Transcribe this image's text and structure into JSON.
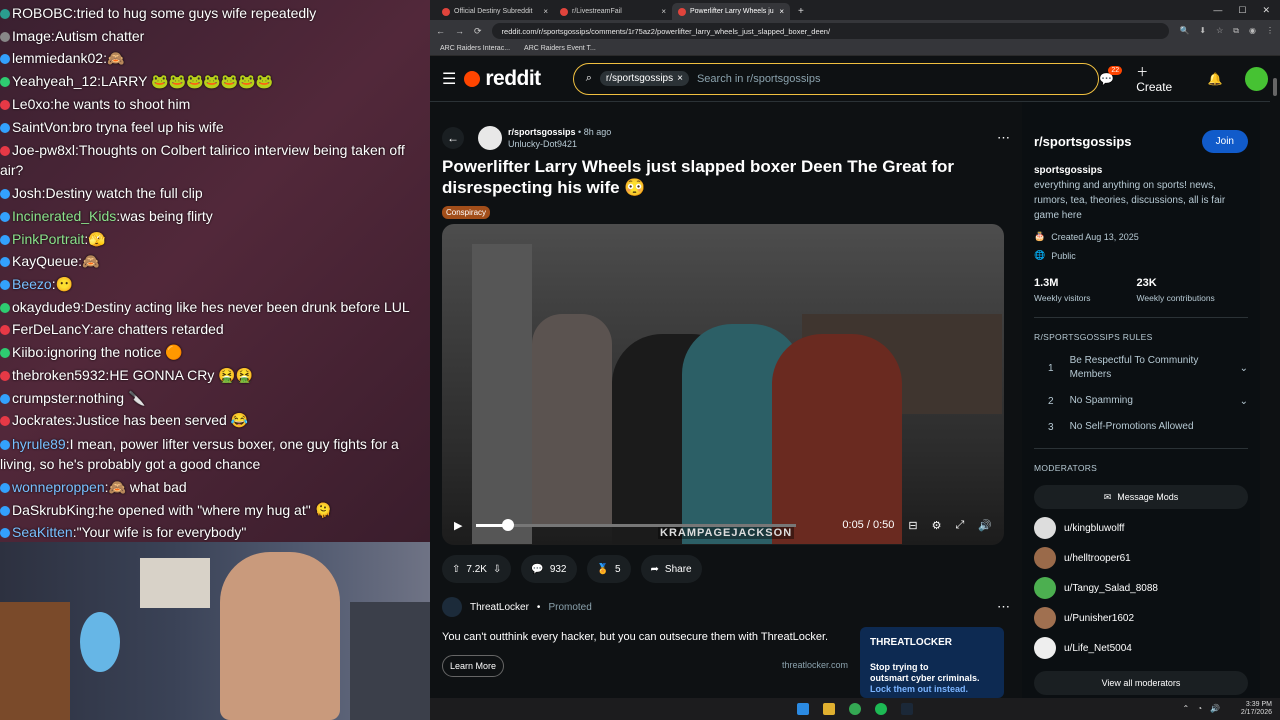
{
  "chat": [
    {
      "user": "ROBOBC",
      "text": "tried to hug some guys wife repeatedly",
      "color": "#ffffff",
      "badge": "#2a9d8f"
    },
    {
      "user": "Image",
      "text": "Autism chatter",
      "color": "#ffffff",
      "badge": "#888888"
    },
    {
      "user": "lemmiedank02",
      "text": "🙈",
      "color": "#ffffff",
      "badge": "#33a1fd"
    },
    {
      "user": "Yeahyeah_12",
      "text": "LARRY 🐸🐸🐸🐸🐸🐸🐸",
      "color": "#ffffff",
      "badge": "#2ecc71"
    },
    {
      "user": "Le0xo",
      "text": "he wants to shoot him",
      "color": "#ffffff",
      "badge": "#e63946"
    },
    {
      "user": "SaintVon",
      "text": "bro tryna feel up his wife",
      "color": "#ffffff",
      "badge": "#33a1fd"
    },
    {
      "user": "Joe-pw8xl",
      "text": "Thoughts on Colbert talirico interview being taken off air?",
      "color": "#ffffff",
      "badge": "#e63946"
    },
    {
      "user": "Josh",
      "text": "Destiny watch the full clip",
      "color": "#ffffff",
      "badge": "#33a1fd"
    },
    {
      "user": "Incinerated_Kids",
      "text": "was being flirty",
      "color": "#8be28b",
      "badge": "#33a1fd"
    },
    {
      "user": "PinkPortrait",
      "text": "🫣",
      "color": "#8be28b",
      "badge": "#33a1fd"
    },
    {
      "user": "KayQueue",
      "text": "🙈",
      "color": "#ffffff",
      "badge": "#33a1fd"
    },
    {
      "user": "Beezo",
      "text": "😶",
      "color": "#79c0ff",
      "badge": "#33a1fd"
    },
    {
      "user": "okaydude9",
      "text": "Destiny acting like hes never been drunk before LUL",
      "color": "#ffffff",
      "badge": "#2ecc71"
    },
    {
      "user": "FerDeLancY",
      "text": "are chatters retarded",
      "color": "#ffffff",
      "badge": "#e63946"
    },
    {
      "user": "Kiibo",
      "text": "ignoring the notice 🟠",
      "color": "#ffffff",
      "badge": "#2ecc71"
    },
    {
      "user": "thebroken5932",
      "text": "HE GONNA CRy 🤮🤮",
      "color": "#ffffff",
      "badge": "#e63946"
    },
    {
      "user": "crumpster",
      "text": "nothing 🔪",
      "color": "#ffffff",
      "badge": "#33a1fd"
    },
    {
      "user": "Jockrates",
      "text": "Justice has been served 😂",
      "color": "#ffffff",
      "badge": "#e63946"
    },
    {
      "user": "hyrule89",
      "text": "I mean, power lifter versus boxer, one guy fights for a living, so he's probably got a good chance",
      "color": "#79c0ff",
      "badge": "#33a1fd"
    },
    {
      "user": "wonneproppen",
      "text": "🙈 what bad",
      "color": "#79c0ff",
      "badge": "#33a1fd"
    },
    {
      "user": "DaSkrubKing",
      "text": "he opened with \"where my hug at\" 🫠",
      "color": "#ffffff",
      "badge": "#33a1fd"
    },
    {
      "user": "SeaKitten",
      "text": "\"Your wife is for everybody\"",
      "color": "#79c0ff",
      "badge": "#33a1fd"
    }
  ],
  "browser": {
    "tabs": [
      "Official Destiny Subreddit",
      "r/LivestreamFail",
      "Powerlifter Larry Wheels ju"
    ],
    "url": "reddit.com/r/sportsgossips/comments/1r75az2/powerlifter_larry_wheels_just_slapped_boxer_deen/",
    "bookmarks": [
      "ARC Raiders Interac...",
      "ARC Raiders Event T..."
    ]
  },
  "reddit": {
    "logo": "reddit",
    "search_chip": "r/sportsgossips",
    "search_placeholder": "Search in r/sportsgossips",
    "notif_count": "22",
    "create_label": "Create",
    "post": {
      "subreddit": "r/sportsgossips",
      "age": "8h ago",
      "author": "Unlucky-Dot9421",
      "title": "Powerlifter Larry Wheels just slapped boxer Deen The Great for disrespecting his wife 😳",
      "flair": "Conspiracy",
      "video_time": "0:05 / 0:50",
      "video_watermark": "KRAMPAGEJACKSON",
      "video_progress": 0.1,
      "votes": "7.2K",
      "comments": "932",
      "awards": "5",
      "share": "Share"
    },
    "promo": {
      "advertiser": "ThreatLocker",
      "promoted": "Promoted",
      "text": "You can't outthink every hacker, but you can outsecure them with ThreatLocker.",
      "learn_more": "Learn More",
      "domain": "threatlocker.com",
      "ad_brand": "THREATLOCKER",
      "ad_line1": "Stop trying to",
      "ad_line2": "outsmart cyber criminals.",
      "ad_line3": "Lock them out instead."
    },
    "sidebar": {
      "title": "r/sportsgossips",
      "join": "Join",
      "name": "sportsgossips",
      "description": "everything and anything on sports! news, rumors, tea, theories, discussions, all is fair game here",
      "created": "Created Aug 13, 2025",
      "visibility": "Public",
      "visitors": "1.3M",
      "visitors_label": "Weekly visitors",
      "contributions": "23K",
      "contributions_label": "Weekly contributions",
      "rules_heading": "R/SPORTSGOSSIPS RULES",
      "rules": [
        {
          "num": "1",
          "text": "Be Respectful To Community Members"
        },
        {
          "num": "2",
          "text": "No Spamming"
        },
        {
          "num": "3",
          "text": "No Self-Promotions Allowed"
        }
      ],
      "mods_heading": "MODERATORS",
      "message_mods": "Message Mods",
      "mods": [
        "u/kingbluwolff",
        "u/helltrooper61",
        "u/Tangy_Salad_8088",
        "u/Punisher1602",
        "u/Life_Net5004"
      ],
      "view_all": "View all moderators"
    }
  },
  "clock": {
    "time": "3:39 PM",
    "date": "2/17/2026"
  }
}
